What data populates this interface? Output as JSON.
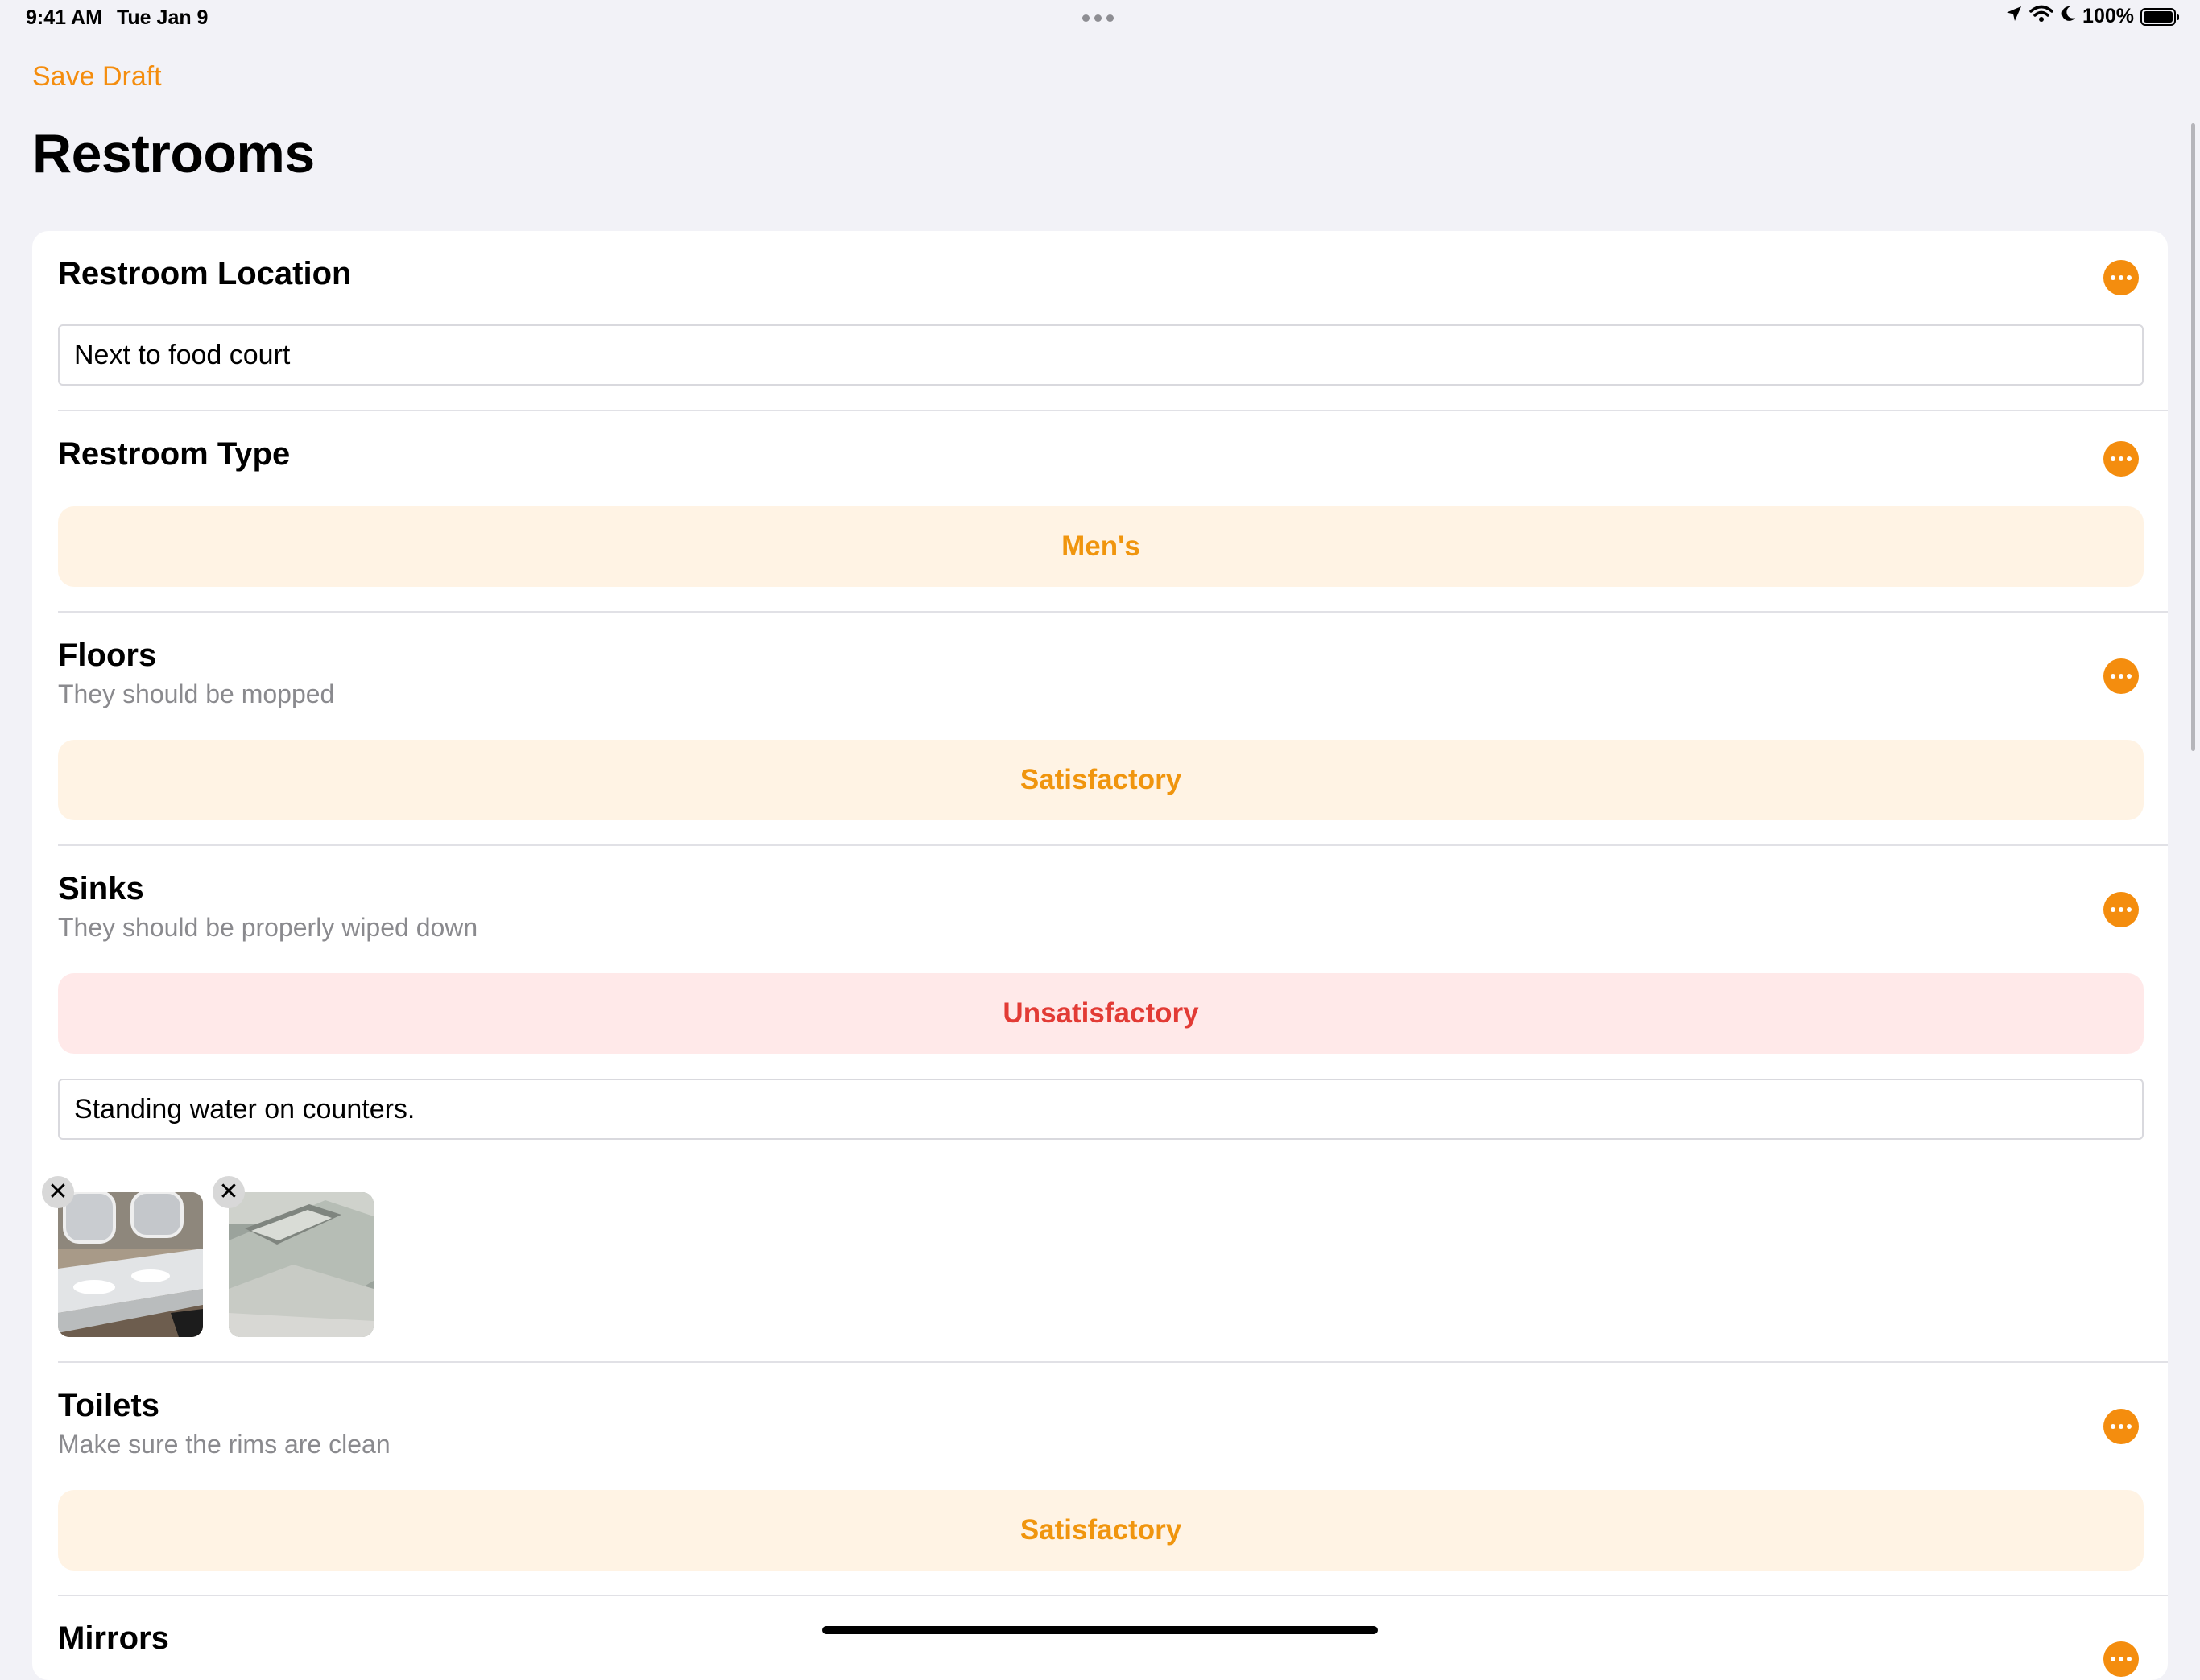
{
  "status_bar": {
    "time": "9:41 AM",
    "date": "Tue Jan 9",
    "battery": "100%"
  },
  "nav": {
    "save_draft": "Save Draft",
    "title": "Restrooms"
  },
  "sections": {
    "location": {
      "title": "Restroom Location",
      "value": "Next to food court"
    },
    "type": {
      "title": "Restroom Type",
      "selection": "Men's"
    },
    "floors": {
      "title": "Floors",
      "subtitle": "They should be mopped",
      "rating": "Satisfactory"
    },
    "sinks": {
      "title": "Sinks",
      "subtitle": "They should be properly wiped down",
      "rating": "Unsatisfactory",
      "note": "Standing water on counters.",
      "photos": [
        "sink-photo-1",
        "sink-photo-2"
      ]
    },
    "toilets": {
      "title": "Toilets",
      "subtitle": "Make sure the rims are clean",
      "rating": "Satisfactory"
    },
    "mirrors": {
      "title": "Mirrors"
    }
  },
  "colors": {
    "accent": "#f48d0e",
    "satisfactory_bg": "#fff3e4",
    "satisfactory_text": "#f0950e",
    "unsatisfactory_bg": "#ffe9e9",
    "unsatisfactory_text": "#e23b35",
    "background": "#f2f2f7"
  },
  "icons": {
    "more": "ellipsis-circle-icon",
    "remove": "xmark-icon",
    "location": "location-arrow-icon",
    "wifi": "wifi-icon",
    "focus": "moon-icon",
    "battery": "battery-icon"
  }
}
